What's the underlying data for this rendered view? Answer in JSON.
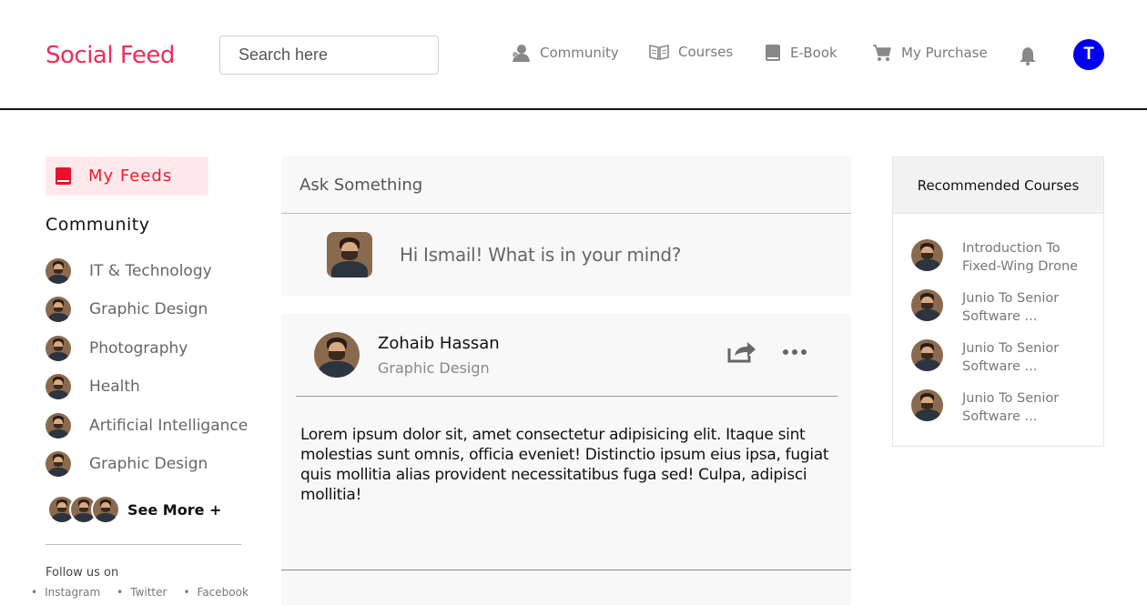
{
  "header": {
    "logo": "Social Feed",
    "search_placeholder": "Search here",
    "nav": [
      {
        "label": "Community",
        "icon": "community-icon"
      },
      {
        "label": "Courses",
        "icon": "book-open-icon"
      },
      {
        "label": "E-Book",
        "icon": "ebook-icon"
      },
      {
        "label": "My Purchase",
        "icon": "cart-icon"
      }
    ],
    "avatar_initial": "T"
  },
  "sidebar": {
    "my_feeds": "My Feeds",
    "community_heading": "Community",
    "communities": [
      "IT & Technology",
      "Graphic Design",
      "Photography",
      "Health",
      "Artificial Intelligance",
      "Graphic Design"
    ],
    "see_more": "See More +",
    "follow_label": "Follow us on",
    "social": [
      "Instagram",
      "Twitter",
      "Facebook"
    ]
  },
  "ask": {
    "title": "Ask Something",
    "prompt": "Hi Ismail! What is in your mind?"
  },
  "post": {
    "author": "Zohaib Hassan",
    "category": "Graphic Design",
    "body": "Lorem ipsum dolor sit, amet consectetur adipisicing elit. Itaque sint molestias sunt omnis, officia eveniet! Distinctio ipsum eius ipsa, fugiat quis mollitia alias provident necessitatibus fuga sed! Culpa, adipisci mollitia!"
  },
  "recommended": {
    "title": "Recommended Courses",
    "courses": [
      "Introduction To Fixed-Wing Drone",
      "Junio To Senior Software ...",
      "Junio To Senior Software ...",
      "Junio To Senior Software ..."
    ]
  },
  "colors": {
    "brand": "#ef2d56",
    "avatar_bg": "#0000ee",
    "feed_highlight": "#ffe9ec"
  }
}
